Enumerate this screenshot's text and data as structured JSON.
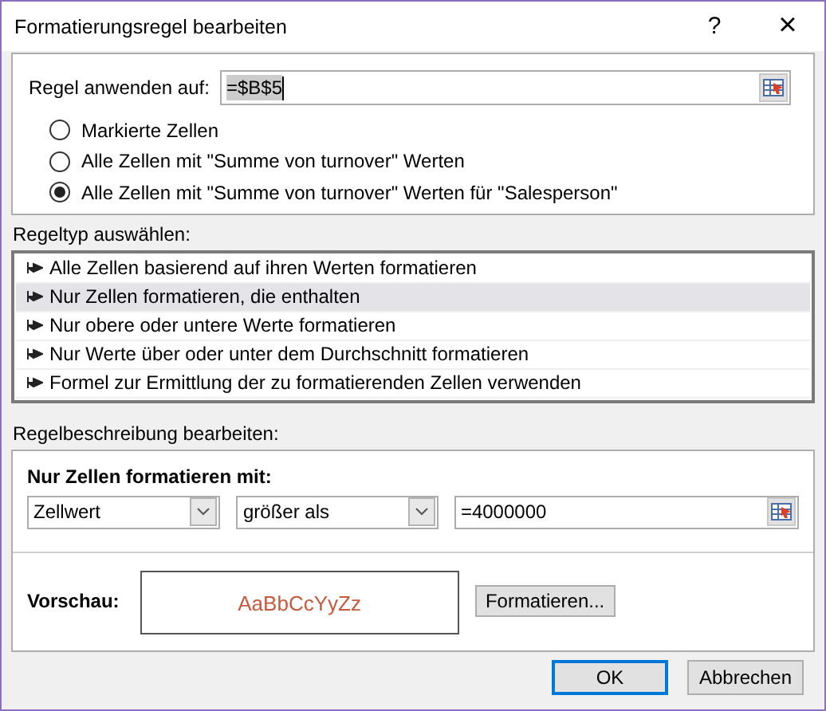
{
  "window": {
    "title": "Formatierungsregel bearbeiten",
    "help": "?",
    "close": "×"
  },
  "apply_to": {
    "label": "Regel anwenden auf:",
    "value": "=$B$5"
  },
  "scope_options": [
    {
      "label": "Markierte Zellen",
      "selected": false
    },
    {
      "label": "Alle Zellen mit \"Summe von turnover\" Werten",
      "selected": false
    },
    {
      "label": "Alle Zellen mit \"Summe von turnover\" Werten für \"Salesperson\"",
      "selected": true
    }
  ],
  "rule_type": {
    "label": "Regeltyp auswählen:",
    "items": [
      {
        "label": "Alle Zellen basierend auf ihren Werten formatieren",
        "selected": false
      },
      {
        "label": "Nur Zellen formatieren, die enthalten",
        "selected": true
      },
      {
        "label": "Nur obere oder untere Werte formatieren",
        "selected": false
      },
      {
        "label": "Nur Werte über oder unter dem Durchschnitt formatieren",
        "selected": false
      },
      {
        "label": "Formel zur Ermittlung der zu formatierenden Zellen verwenden",
        "selected": false
      }
    ]
  },
  "description": {
    "label": "Regelbeschreibung bearbeiten:",
    "heading": "Nur Zellen formatieren mit:",
    "condition": [
      {
        "kind": "dropdown",
        "value": "Zellwert"
      },
      {
        "kind": "dropdown",
        "value": "größer als"
      },
      {
        "kind": "reference",
        "value": "=4000000"
      }
    ],
    "preview": {
      "label": "Vorschau:",
      "sample": "AaBbCcYyZz"
    },
    "format_button": "Formatieren..."
  },
  "buttons": [
    {
      "label": "OK",
      "default": true
    },
    {
      "label": "Abbrechen",
      "default": false
    }
  ]
}
